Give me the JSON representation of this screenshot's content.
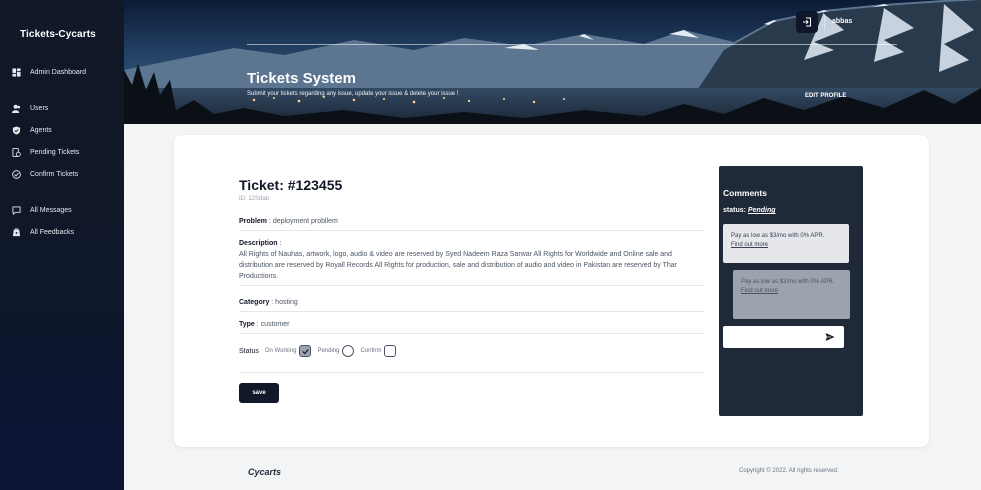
{
  "sidebar": {
    "brand": "Tickets-Cycarts",
    "items": [
      {
        "label": "Admin Dashboard",
        "icon": "dashboard-icon"
      },
      {
        "label": "Users",
        "icon": "users-icon"
      },
      {
        "label": "Agents",
        "icon": "shield-icon"
      },
      {
        "label": "Pending Tickets",
        "icon": "pending-icon"
      },
      {
        "label": "Confirm Tickets",
        "icon": "check-circle-icon"
      },
      {
        "label": "All Messages",
        "icon": "message-icon"
      },
      {
        "label": "All Feedbacks",
        "icon": "feedback-icon"
      }
    ]
  },
  "header": {
    "title": "Tickets System",
    "subtitle": "Submit your tickets regarding any issue, update your issue & delete your issue !",
    "edit_profile": "EDIT PROFILE",
    "user": "abbas"
  },
  "ticket": {
    "title": "Ticket: #123455",
    "id": "ID: 12Sdab",
    "problem_label": "Problem",
    "problem": ": deployment probllem",
    "description_label": "Description",
    "description_suffix": ":",
    "description": "All Rights of Nauhas, artwork, logo, audio & video are reserved by Syed Nadeem Raza Sarwar All Rights for Worldwide and Online sale and distribution are reserved by Royall Records All Rights for production, sale and distribution of audio and video in Pakistan are reserved by Thar Productions.",
    "category_label": "Category",
    "category": ": hosting",
    "type_label": "Type",
    "type": ": customer",
    "status_label": "Status",
    "status_options": [
      "On Working",
      "Pending",
      "Confirm"
    ],
    "save_label": "save"
  },
  "comments": {
    "title": "Comments",
    "status_label": "status:",
    "status_value": "Pending",
    "messages": [
      {
        "text": "Pay as low as $3/mo with 0% APR.",
        "link": "Find out more"
      },
      {
        "text": "Pay as low as $3/mo with 0% APR.",
        "link": "Find out more"
      }
    ]
  },
  "footer": {
    "brand": "Cycarts",
    "copyright": "Copyright © 2022. All rights reserved."
  }
}
